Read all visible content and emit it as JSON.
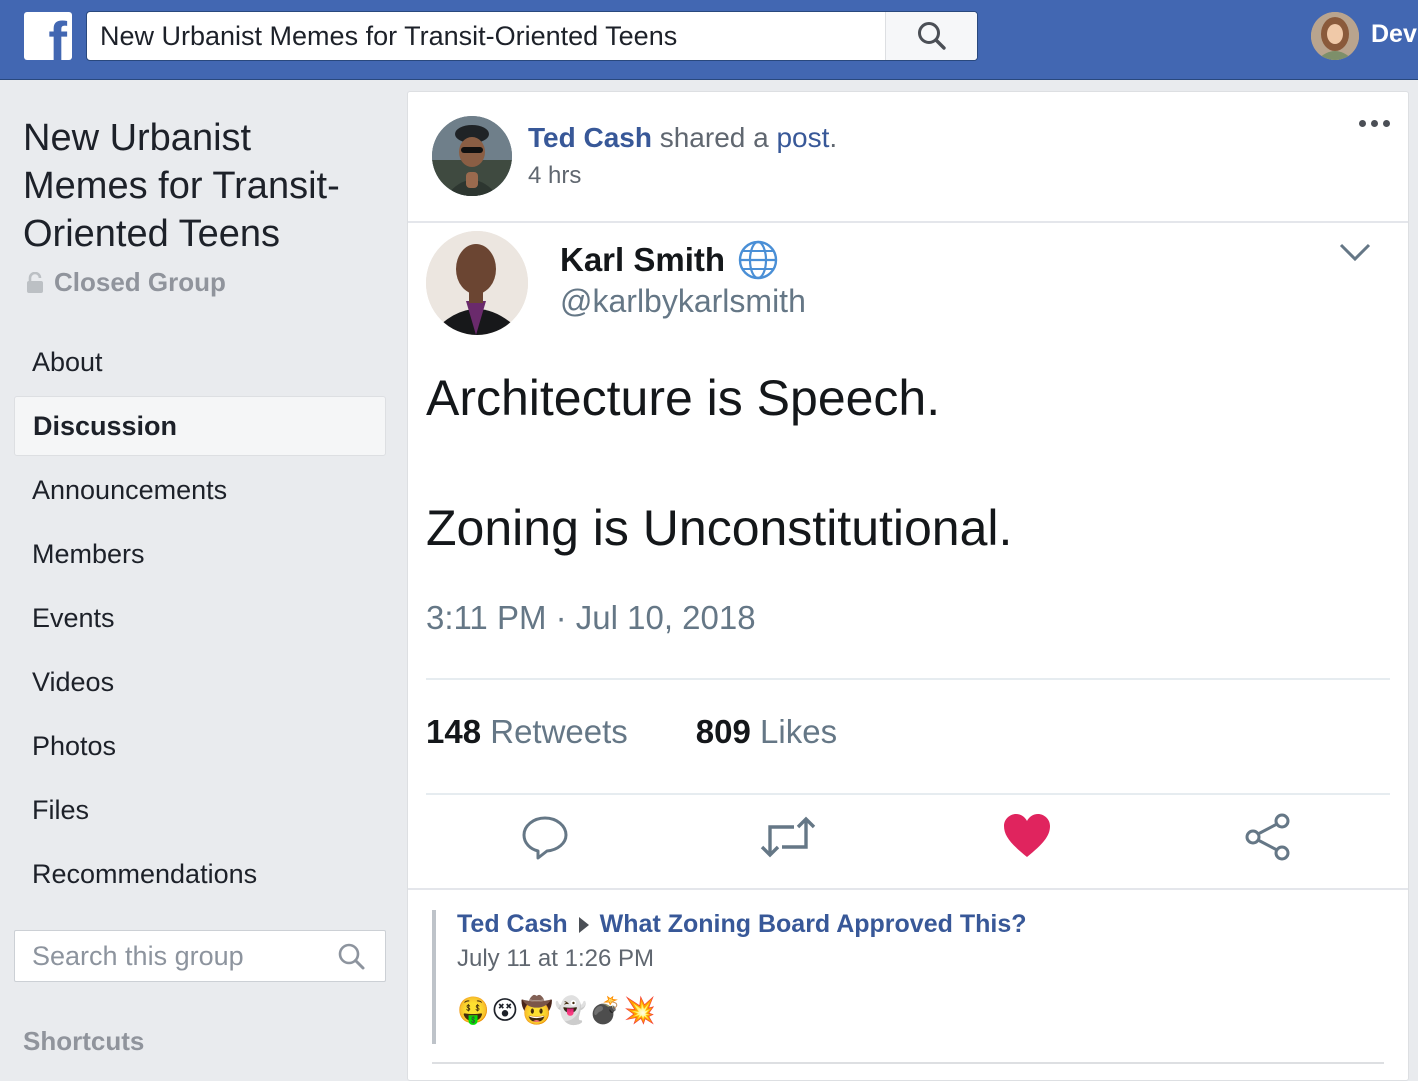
{
  "topbar": {
    "logo_letter": "f",
    "search_value": "New Urbanist Memes for Transit-Oriented Teens",
    "user_name": "Dev"
  },
  "group": {
    "title": "New Urbanist Memes for Transit-Oriented Teens",
    "privacy": "Closed Group",
    "nav": [
      {
        "label": "About",
        "active": false
      },
      {
        "label": "Discussion",
        "active": true
      },
      {
        "label": "Announcements",
        "active": false
      },
      {
        "label": "Members",
        "active": false
      },
      {
        "label": "Events",
        "active": false
      },
      {
        "label": "Videos",
        "active": false
      },
      {
        "label": "Photos",
        "active": false
      },
      {
        "label": "Files",
        "active": false
      },
      {
        "label": "Recommendations",
        "active": false
      }
    ],
    "search_placeholder": "Search this group",
    "shortcuts_label": "Shortcuts"
  },
  "post": {
    "author": "Ted Cash",
    "action_text": "shared a",
    "action_link": "post",
    "action_end": ".",
    "time": "4 hrs"
  },
  "tweet": {
    "name": "Karl Smith",
    "handle": "@karlbykarlsmith",
    "line1": "Architecture is Speech.",
    "line2": "Zoning is Unconstitutional.",
    "date": "3:11 PM · Jul 10, 2018",
    "retweets_count": "148",
    "retweets_label": "Retweets",
    "likes_count": "809",
    "likes_label": "Likes"
  },
  "shared": {
    "author": "Ted Cash",
    "target": "What Zoning Board Approved This?",
    "date": "July 11 at 1:26 PM",
    "emojis": "🤑😵🤠👻💣💥"
  },
  "colors": {
    "fb_blue": "#4267b2",
    "link_blue": "#385898",
    "like_red": "#e0245e",
    "muted_gray": "#90949c"
  }
}
